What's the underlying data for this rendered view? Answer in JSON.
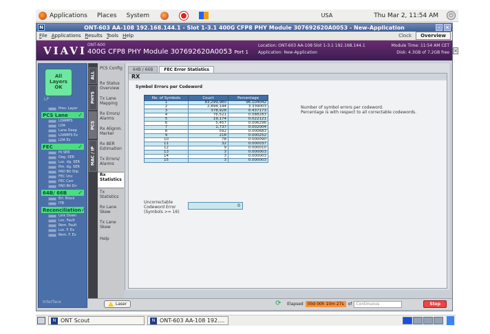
{
  "top_panel": {
    "menus": [
      "Applications",
      "Places",
      "System"
    ],
    "keyboard": "USA",
    "clock": "Thu Mar  2, 11:54 AM"
  },
  "window": {
    "title": "ONT-603  AA-108 192.168.144.1 - Slot 1-3.1 400G CFP8 PHY Module 307692620A0053 - New-Application",
    "menus": [
      "File",
      "Applications",
      "Results",
      "Tools",
      "Help"
    ],
    "clock_btn": "Clock",
    "overview_btn": "Overview"
  },
  "header": {
    "logo": "VIAVI",
    "badge": "ONT-600",
    "module": "400G CFP8 PHY Module 307692620A0053",
    "port": "Port 1",
    "location": "Location: ONT-603 AA-108 Slot 1-3.1 192.168.144.1",
    "module_time": "Module Time: 11:54 AM CET",
    "application": "Application: New-Application",
    "disk": "Disk: 4.3GB of 7.2GB free"
  },
  "alarm_panel": {
    "summary": [
      "All",
      "Layers",
      "OK"
    ],
    "badge": "LP",
    "groups": [
      {
        "label": "PCS Lane",
        "top": 0
      },
      {
        "label": "FEC",
        "top": 0
      },
      {
        "label": "64B/ 66B",
        "top": 0
      },
      {
        "label": "Reconciliation",
        "top": 0
      }
    ],
    "items_top": [
      "Prev. Layer"
    ],
    "items_pcs": [
      "LOAMPS",
      "LOA",
      "Lane Deep",
      "LOAMPS Ex",
      "LOA Ex"
    ],
    "items_fec": [
      "Hi SER",
      "Deg. SER",
      "Loc. dg. SER",
      "Rm. dg. SER",
      "PAD Bit Slip",
      "FEC Unc",
      "FEC Corr",
      "PAD Bit Err"
    ],
    "items_64b": [
      "Err. Block",
      "ITB"
    ],
    "items_rec": [
      "Link Down",
      "Loc. Fault",
      "Rem. Fault",
      "Loc. F. Ex",
      "Rem. F. Ex"
    ],
    "interface": "Interface"
  },
  "vtabs": [
    "ALL",
    "PHYS",
    "PCS",
    "MAC / IP"
  ],
  "nav": [
    "PCS Config",
    "Rx Status Overview",
    "Tx Lane Mapping",
    "Rx Errors/ Alarms",
    "Rx Alignm. Marker",
    "Rx BER Estimation",
    "Tx Errors/ Alarms",
    "Rx Statistics",
    "Tx Statistics",
    "Rx Lane Skew",
    "Tx Lane Skew",
    "Help"
  ],
  "tabs": [
    "64B / 66B",
    "FEC Error Statistics"
  ],
  "content": {
    "title": "RX",
    "section": "Symbol Errors per Codeword",
    "columns": [
      "No. of Symbols",
      "Count",
      "Percentage"
    ],
    "rows": [
      [
        "1",
        "83,299,980",
        "96.104042"
      ],
      [
        "2",
        "2,894,144",
        "3.339003"
      ],
      [
        "3",
        "378,928",
        "0.437173"
      ],
      [
        "4",
        "76,521",
        "0.088283"
      ],
      [
        "5",
        "19,174",
        "0.022121"
      ],
      [
        "6",
        "5,457",
        "0.006296"
      ],
      [
        "7",
        "1,737",
        "0.002004"
      ],
      [
        "8",
        "592",
        "0.000683"
      ],
      [
        "9",
        "218",
        "0.000252"
      ],
      [
        "10",
        "78",
        "0.000090"
      ],
      [
        "11",
        "32",
        "0.000037"
      ],
      [
        "12",
        "9",
        "0.000010"
      ],
      [
        "13",
        "3",
        "0.000003"
      ],
      [
        "14",
        "3",
        "0.000003"
      ],
      [
        "15",
        "3",
        "0.000003"
      ]
    ],
    "desc_1": "Number of symbol errors per codeword.",
    "desc_2": "Percentage is with respect to all correctable codewords.",
    "uncorr_label": [
      "Uncorrectable",
      "Codeword Error",
      "(Symbols >= 16)"
    ],
    "uncorr_value": "0"
  },
  "status": {
    "laser": "Laser",
    "elapsed_label": "Elapsed",
    "elapsed_value": "00d 00h 10m 27s",
    "of": "of",
    "duration": "Continuous",
    "stop": "Stop"
  },
  "taskbar": {
    "items": [
      "ONT Scout",
      "ONT-603  AA-108 192...."
    ]
  }
}
